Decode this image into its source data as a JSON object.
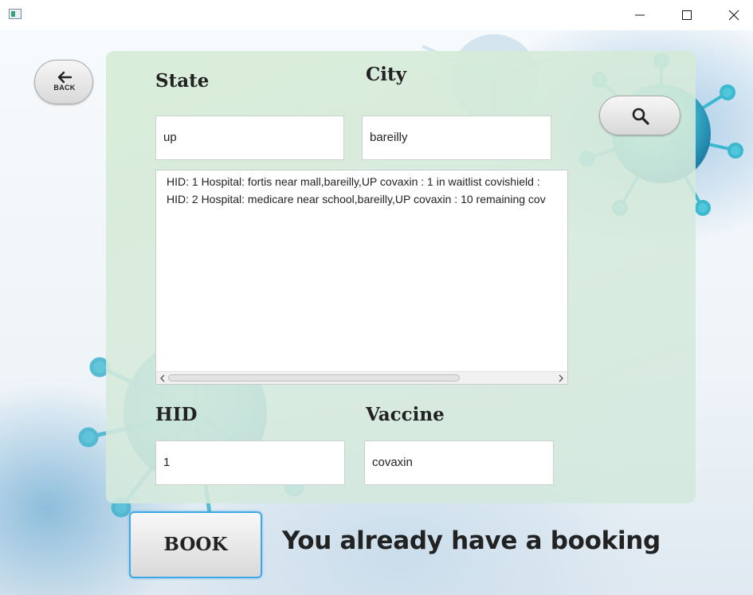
{
  "window": {
    "controls": {
      "minimize_icon": "minimize-icon",
      "maximize_icon": "maximize-icon",
      "close_icon": "close-icon"
    }
  },
  "nav": {
    "back_label": "BACK",
    "back_icon": "arrow-left-icon"
  },
  "search": {
    "icon": "search-icon"
  },
  "form": {
    "state": {
      "label": "State",
      "value": "up"
    },
    "city": {
      "label": "City",
      "value": "bareilly"
    },
    "hid": {
      "label": "HID",
      "value": "1"
    },
    "vaccine": {
      "label": "Vaccine",
      "value": "covaxin"
    }
  },
  "results": {
    "lines": [
      "HID: 1 Hospital: fortis near mall,bareilly,UP covaxin :  1 in waitlist  covishield :",
      "HID: 2 Hospital: medicare near school,bareilly,UP covaxin :  10 remaining  cov"
    ]
  },
  "actions": {
    "book_label": "BOOK"
  },
  "status": {
    "message": "You already have a booking"
  },
  "colors": {
    "accent": "#3fa9e6",
    "panel": "#d6ecd6",
    "virus": "#3cb8cf"
  }
}
